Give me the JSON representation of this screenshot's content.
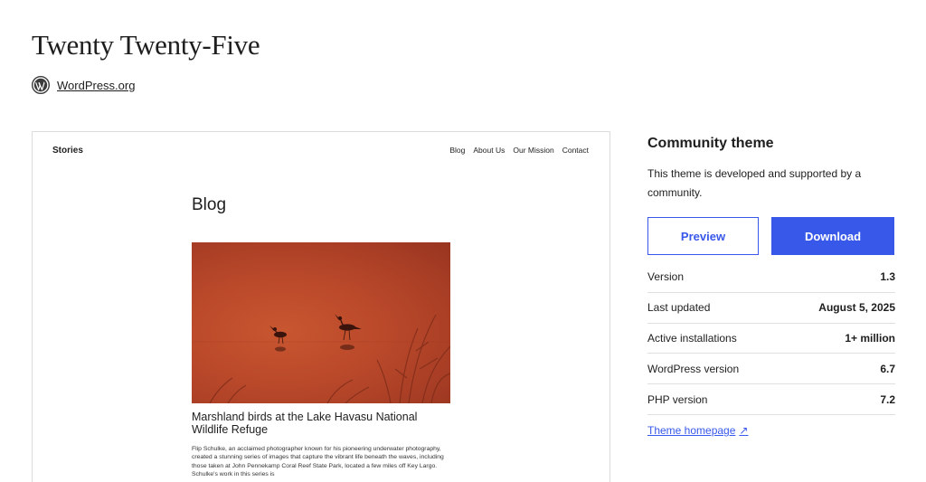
{
  "theme": {
    "title": "Twenty Twenty-Five",
    "author": "WordPress.org"
  },
  "preview": {
    "site_title": "Stories",
    "nav": [
      "Blog",
      "About Us",
      "Our Mission",
      "Contact"
    ],
    "page_title": "Blog",
    "post_title": "Marshland birds at the Lake Havasu National Wildlife Refuge",
    "post_excerpt": "Flip Schulke, an acclaimed photographer known for his pioneering underwater photography, created a stunning series of images that capture the vibrant life beneath the waves, including those taken at John Pennekamp Coral Reef State Park, located a few miles off Key Largo. Schulke's work in this series is"
  },
  "sidebar": {
    "community_title": "Community theme",
    "community_desc": "This theme is developed and supported by a community.",
    "preview_button": "Preview",
    "download_button": "Download",
    "meta": [
      {
        "label": "Version",
        "value": "1.3"
      },
      {
        "label": "Last updated",
        "value": "August 5, 2025"
      },
      {
        "label": "Active installations",
        "value": "1+ million"
      },
      {
        "label": "WordPress version",
        "value": "6.7"
      },
      {
        "label": "PHP version",
        "value": "7.2"
      }
    ],
    "homepage_link": "Theme homepage",
    "homepage_icon": "arrow-up-right-icon"
  },
  "colors": {
    "accent": "#3858e9",
    "image_bg": "#b9482a"
  }
}
